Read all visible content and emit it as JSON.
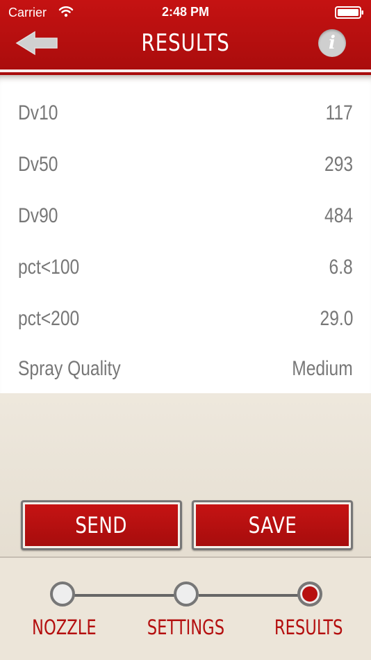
{
  "status_bar": {
    "carrier": "Carrier",
    "time": "2:48 PM"
  },
  "header": {
    "title": "RESULTS",
    "back_icon": "back-arrow-icon",
    "info_icon": "info-icon",
    "info_label": "i",
    "accent_color": "#b70f0f"
  },
  "results": [
    {
      "label": "Dv10",
      "value": "117"
    },
    {
      "label": "Dv50",
      "value": "293"
    },
    {
      "label": "Dv90",
      "value": "484"
    },
    {
      "label": "pct<100",
      "value": "6.8"
    },
    {
      "label": "pct<200",
      "value": "29.0"
    },
    {
      "label": "Spray Quality",
      "value": "Medium"
    }
  ],
  "actions": {
    "send": "SEND",
    "save": "SAVE"
  },
  "steps": [
    {
      "label": "NOZZLE",
      "active": false
    },
    {
      "label": "SETTINGS",
      "active": false
    },
    {
      "label": "RESULTS",
      "active": true
    }
  ]
}
